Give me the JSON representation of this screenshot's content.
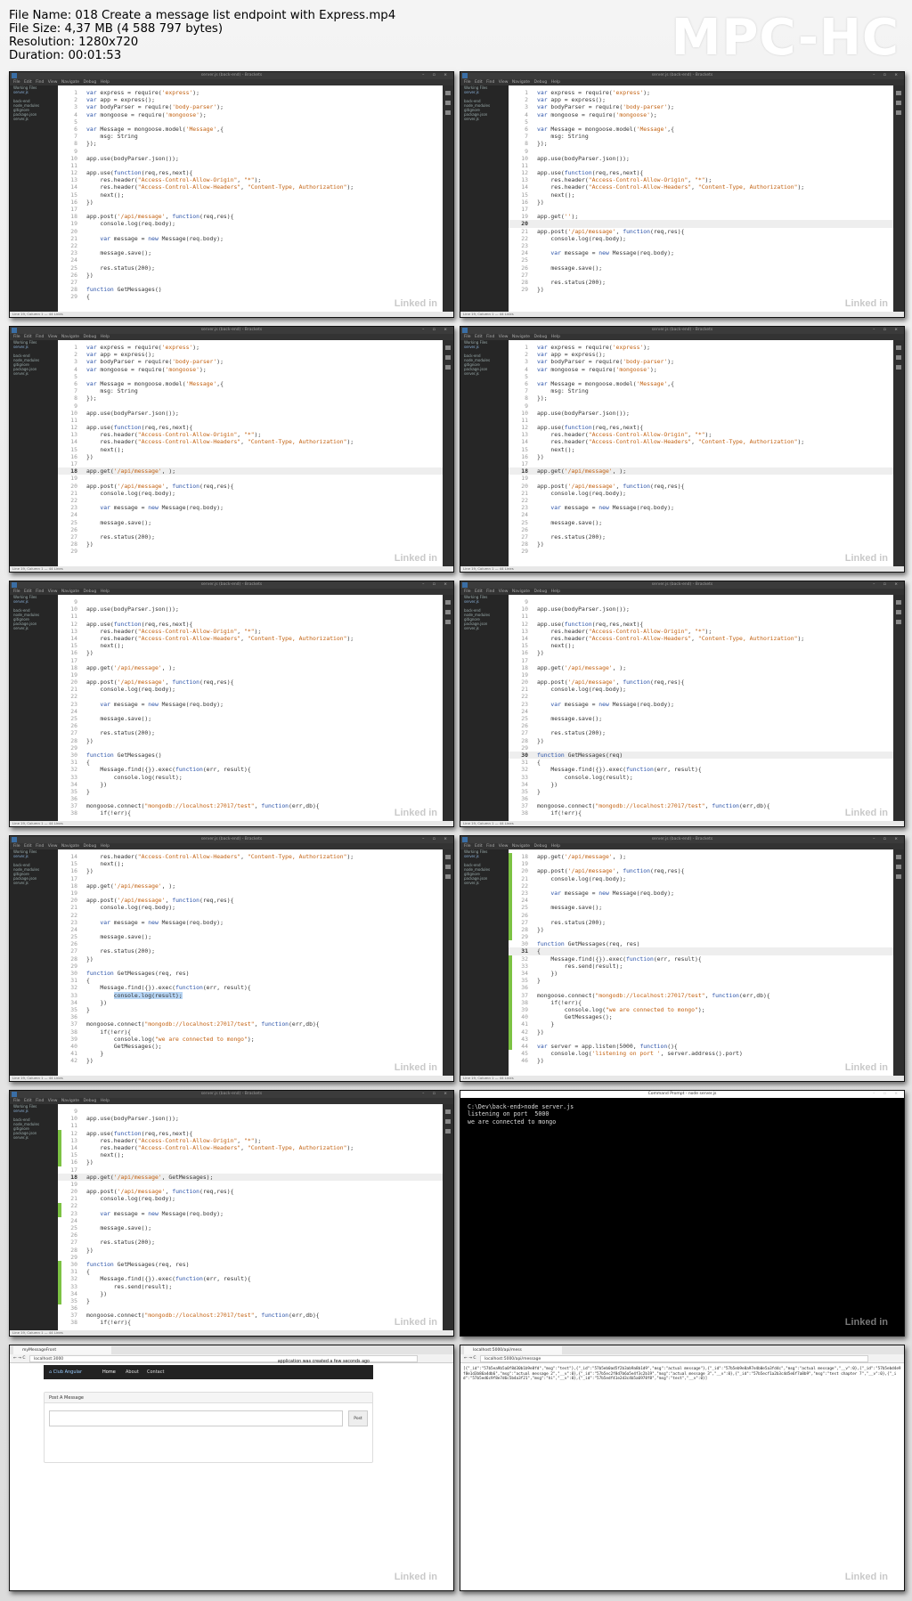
{
  "header": {
    "file_name": "File Name: 018 Create a message list endpoint with Express.mp4",
    "file_size": "File Size: 4,37 MB (4 588 797 bytes)",
    "resolution": "Resolution: 1280x720",
    "duration": "Duration: 00:01:53",
    "logo": "MPC-HC"
  },
  "editor": {
    "title": "server.js (back-end) - Brackets",
    "menu": "File Edit Find View Navigate Debug Help",
    "sidebar": [
      "Working Files",
      "server.js",
      "",
      "back-end",
      "node_modules",
      "gitignore",
      "package.json",
      "server.js"
    ],
    "status": "Line 19, Column 1 — 44 Lines",
    "watermark": "Linked in"
  },
  "code": {
    "top": [
      [
        "1",
        "var express = require('express');"
      ],
      [
        "2",
        "var app = express();"
      ],
      [
        "3",
        "var bodyParser = require('body-parser');"
      ],
      [
        "4",
        "var mongoose = require('mongoose');"
      ],
      [
        "5",
        ""
      ],
      [
        "6",
        "var Message = mongoose.model('Message',{"
      ],
      [
        "7",
        "    msg: String"
      ],
      [
        "8",
        "});"
      ],
      [
        "9",
        ""
      ],
      [
        "10",
        "app.use(bodyParser.json());"
      ],
      [
        "11",
        ""
      ],
      [
        "12",
        "app.use(function(req,res,next){"
      ],
      [
        "13",
        "    res.header(\"Access-Control-Allow-Origin\", \"*\");"
      ],
      [
        "14",
        "    res.header(\"Access-Control-Allow-Headers\", \"Content-Type, Authorization\");"
      ],
      [
        "15",
        "    next();"
      ],
      [
        "16",
        "})"
      ],
      [
        "17",
        ""
      ]
    ],
    "tile1_tail": [
      [
        "18",
        "app.post('/api/message', function(req,res){"
      ],
      [
        "19",
        "    console.log(req.body);"
      ],
      [
        "20",
        ""
      ],
      [
        "21",
        "    var message = new Message(req.body);"
      ],
      [
        "22",
        ""
      ],
      [
        "23",
        "    message.save();"
      ],
      [
        "24",
        ""
      ],
      [
        "25",
        "    res.status(200);"
      ],
      [
        "26",
        "})"
      ],
      [
        "27",
        ""
      ],
      [
        "28",
        "function GetMessages()"
      ],
      [
        "29",
        "{"
      ]
    ],
    "tile2_tail": [
      [
        "18",
        ""
      ],
      [
        "19",
        "app.get('');"
      ],
      [
        "20",
        ""
      ],
      [
        "21",
        "app.post('/api/message', function(req,res){"
      ],
      [
        "22",
        "    console.log(req.body);"
      ],
      [
        "23",
        ""
      ],
      [
        "24",
        "    var message = new Message(req.body);"
      ],
      [
        "25",
        ""
      ],
      [
        "26",
        "    message.save();"
      ],
      [
        "27",
        ""
      ],
      [
        "28",
        "    res.status(200);"
      ],
      [
        "29",
        "})"
      ]
    ],
    "tile3_tail": [
      [
        "18",
        "app.get('/api/message', );"
      ],
      [
        "19",
        ""
      ],
      [
        "20",
        "app.post('/api/message', function(req,res){"
      ],
      [
        "21",
        "    console.log(req.body);"
      ],
      [
        "22",
        ""
      ],
      [
        "23",
        "    var message = new Message(req.body);"
      ],
      [
        "24",
        ""
      ],
      [
        "25",
        "    message.save();"
      ],
      [
        "26",
        ""
      ],
      [
        "27",
        "    res.status(200);"
      ],
      [
        "28",
        "})"
      ],
      [
        "29",
        ""
      ]
    ],
    "mid": [
      [
        "9",
        ""
      ],
      [
        "10",
        "app.use(bodyParser.json());"
      ],
      [
        "11",
        ""
      ],
      [
        "12",
        "app.use(function(req,res,next){"
      ],
      [
        "13",
        "    res.header(\"Access-Control-Allow-Origin\", \"*\");"
      ],
      [
        "14",
        "    res.header(\"Access-Control-Allow-Headers\", \"Content-Type, Authorization\");"
      ],
      [
        "15",
        "    next();"
      ],
      [
        "16",
        "})"
      ],
      [
        "17",
        ""
      ],
      [
        "18",
        "app.get('/api/message', );"
      ],
      [
        "19",
        ""
      ],
      [
        "20",
        "app.post('/api/message', function(req,res){"
      ],
      [
        "21",
        "    console.log(req.body);"
      ],
      [
        "22",
        ""
      ],
      [
        "23",
        "    var message = new Message(req.body);"
      ],
      [
        "24",
        ""
      ],
      [
        "25",
        "    message.save();"
      ],
      [
        "26",
        ""
      ],
      [
        "27",
        "    res.status(200);"
      ],
      [
        "28",
        "})"
      ],
      [
        "29",
        ""
      ],
      [
        "30",
        "function GetMessages()"
      ],
      [
        "31",
        "{"
      ],
      [
        "32",
        "    Message.find({}).exec(function(err, result){"
      ],
      [
        "33",
        "        console.log(result);"
      ],
      [
        "34",
        "    })"
      ],
      [
        "35",
        "}"
      ],
      [
        "36",
        ""
      ],
      [
        "37",
        "mongoose.connect(\"mongodb://localhost:27017/test\", function(err,db){"
      ],
      [
        "38",
        "    if(!err){"
      ]
    ],
    "tile7": [
      [
        "14",
        "    res.header(\"Access-Control-Allow-Headers\", \"Content-Type, Authorization\");"
      ],
      [
        "15",
        "    next();"
      ],
      [
        "16",
        "})"
      ],
      [
        "17",
        ""
      ],
      [
        "18",
        "app.get('/api/message', );"
      ],
      [
        "19",
        ""
      ],
      [
        "20",
        "app.post('/api/message', function(req,res){"
      ],
      [
        "21",
        "    console.log(req.body);"
      ],
      [
        "22",
        ""
      ],
      [
        "23",
        "    var message = new Message(req.body);"
      ],
      [
        "24",
        ""
      ],
      [
        "25",
        "    message.save();"
      ],
      [
        "26",
        ""
      ],
      [
        "27",
        "    res.status(200);"
      ],
      [
        "28",
        "})"
      ],
      [
        "29",
        ""
      ],
      [
        "30",
        "function GetMessages(req, res)"
      ],
      [
        "31",
        "{"
      ],
      [
        "32",
        "    Message.find({}).exec(function(err, result){"
      ],
      [
        "33",
        "        console.log(result);"
      ],
      [
        "34",
        "    })"
      ],
      [
        "35",
        "}"
      ],
      [
        "36",
        ""
      ],
      [
        "37",
        "mongoose.connect(\"mongodb://localhost:27017/test\", function(err,db){"
      ],
      [
        "38",
        "    if(!err){"
      ],
      [
        "39",
        "        console.log(\"we are connected to mongo\");"
      ],
      [
        "40",
        "        GetMessages();"
      ],
      [
        "41",
        "    }"
      ],
      [
        "42",
        "})"
      ]
    ],
    "tile8": [
      [
        "18",
        "app.get('/api/message', );"
      ],
      [
        "19",
        ""
      ],
      [
        "20",
        "app.post('/api/message', function(req,res){"
      ],
      [
        "21",
        "    console.log(req.body);"
      ],
      [
        "22",
        ""
      ],
      [
        "23",
        "    var message = new Message(req.body);"
      ],
      [
        "24",
        ""
      ],
      [
        "25",
        "    message.save();"
      ],
      [
        "26",
        ""
      ],
      [
        "27",
        "    res.status(200);"
      ],
      [
        "28",
        "})"
      ],
      [
        "29",
        ""
      ],
      [
        "30",
        "function GetMessages(req, res)"
      ],
      [
        "31",
        "{"
      ],
      [
        "32",
        "    Message.find({}).exec(function(err, result){"
      ],
      [
        "33",
        "        res.send(result);"
      ],
      [
        "34",
        "    })"
      ],
      [
        "35",
        "}"
      ],
      [
        "36",
        ""
      ],
      [
        "37",
        "mongoose.connect(\"mongodb://localhost:27017/test\", function(err,db){"
      ],
      [
        "38",
        "    if(!err){"
      ],
      [
        "39",
        "        console.log(\"we are connected to mongo\");"
      ],
      [
        "40",
        "        GetMessages();"
      ],
      [
        "41",
        "    }"
      ],
      [
        "42",
        "})"
      ],
      [
        "43",
        ""
      ],
      [
        "44",
        "var server = app.listen(5000, function(){"
      ],
      [
        "45",
        "    console.log('listening on port ', server.address().port)"
      ],
      [
        "46",
        "})"
      ]
    ],
    "tile9": [
      [
        "9",
        ""
      ],
      [
        "10",
        "app.use(bodyParser.json());"
      ],
      [
        "11",
        ""
      ],
      [
        "12",
        "app.use(function(req,res,next){"
      ],
      [
        "13",
        "    res.header(\"Access-Control-Allow-Origin\", \"*\");"
      ],
      [
        "14",
        "    res.header(\"Access-Control-Allow-Headers\", \"Content-Type, Authorization\");"
      ],
      [
        "15",
        "    next();"
      ],
      [
        "16",
        "})"
      ],
      [
        "17",
        ""
      ],
      [
        "18",
        "app.get('/api/message', GetMessages);"
      ],
      [
        "19",
        ""
      ],
      [
        "20",
        "app.post('/api/message', function(req,res){"
      ],
      [
        "21",
        "    console.log(req.body);"
      ],
      [
        "22",
        ""
      ],
      [
        "23",
        "    var message = new Message(req.body);"
      ],
      [
        "24",
        ""
      ],
      [
        "25",
        "    message.save();"
      ],
      [
        "26",
        ""
      ],
      [
        "27",
        "    res.status(200);"
      ],
      [
        "28",
        "})"
      ],
      [
        "29",
        ""
      ],
      [
        "30",
        "function GetMessages(req, res)"
      ],
      [
        "31",
        "{"
      ],
      [
        "32",
        "    Message.find({}).exec(function(err, result){"
      ],
      [
        "33",
        "        res.send(result);"
      ],
      [
        "34",
        "    })"
      ],
      [
        "35",
        "}"
      ],
      [
        "36",
        ""
      ],
      [
        "37",
        "mongoose.connect(\"mongodb://localhost:27017/test\", function(err,db){"
      ],
      [
        "38",
        "    if(!err){"
      ]
    ]
  },
  "cmd": {
    "title": "Command Prompt - node server.js",
    "lines": [
      "C:\\Dev\\back-end>node server.js",
      "listening on port  5000",
      "we are connected to mongo"
    ]
  },
  "browser_app": {
    "tab": "myMessageFront",
    "url": "localhost:3000",
    "brand": "Club Angular",
    "nav": [
      "Home",
      "About",
      "Contact"
    ],
    "notice": "application was created a few seconds ago",
    "panel_title": "Post A Message",
    "post_button": "Post"
  },
  "browser_api": {
    "tab": "localhost:5000/api/mess",
    "url": "localhost:5000/api/message",
    "json": "[{\"_id\":\"57b5ea9b5a0f8d30b1b9e8fd\",\"msg\":\"test\"},{\"_id\":\"57b5eb0ad5f2b3ab9a8b1d9\",\"msg\":\"actual message\"},{\"_id\":\"57b5eb9e8a97e4b0e5a3fd4c\",\"msg\":\"actual message\",\"__v\":0},{\"_id\":\"57b5ebd4e9f8e1d3b86a4db6\",\"msg\":\"actual message 2\",\"__v\":0},{\"_id\":\"57b5ec2f8d7b6a5e4f3c2b19\",\"msg\":\"actual message 3\",\"__v\":0},{\"_id\":\"57b5ecf1a2b3c4d5e6f7a8b9\",\"msg\":\"test chapter 7\",\"__v\":0},{\"_id\":\"57b5ed6c9f8e7d6c5b4a3f21\",\"msg\":\"hi\",\"__v\":0},{\"_id\":\"57b5edf41e2d3c4b5a6978f8\",\"msg\":\"test\",\"__v\":0}]"
  }
}
